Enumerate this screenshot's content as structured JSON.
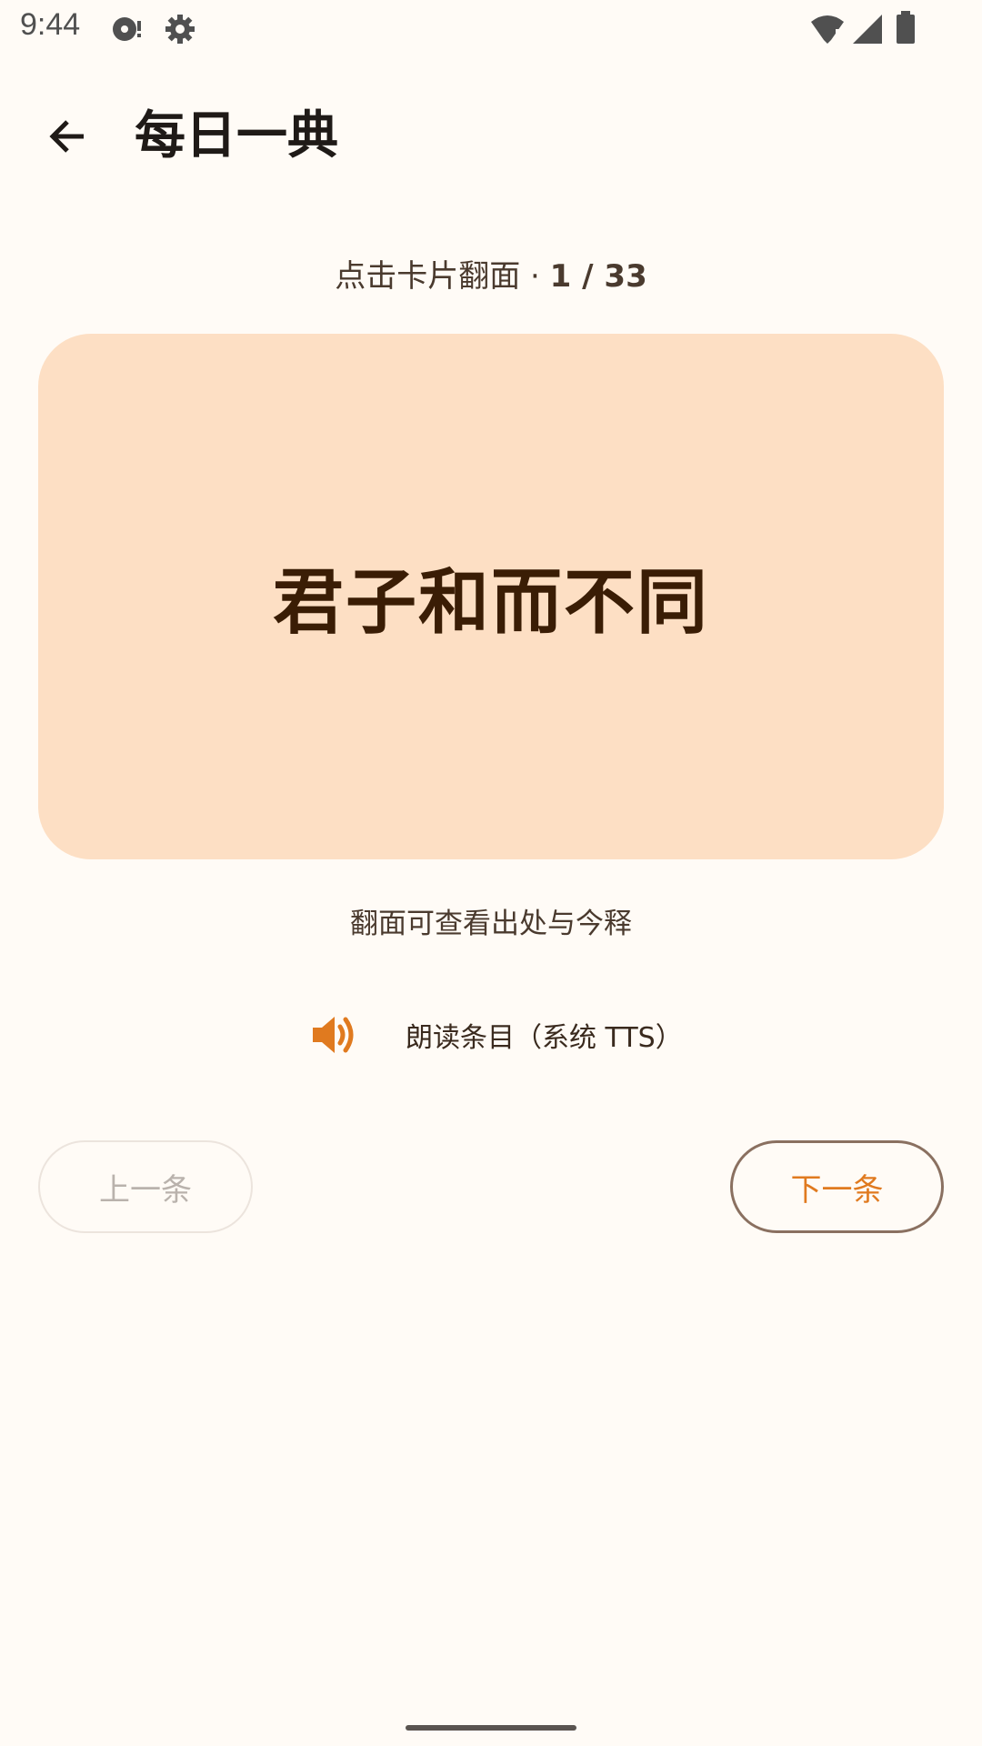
{
  "status_bar": {
    "time": "9:44"
  },
  "app_bar": {
    "title": "每日一典"
  },
  "card": {
    "hint_prefix": "点击卡片翻面 · ",
    "counter": "1 / 33",
    "front_text": "君子和而不同",
    "flip_tip": "翻面可查看出处与今释"
  },
  "tts": {
    "label": "朗读条目（系统 TTS）"
  },
  "buttons": {
    "prev_label": "上一条",
    "next_label": "下一条"
  },
  "colors": {
    "background": "#FFFBF6",
    "card_background": "#FDDFC4",
    "card_text": "#3A1D05",
    "accent": "#E07A1F",
    "disabled_text": "#B9B2AC"
  },
  "icons": {
    "back": "arrow-left-icon",
    "tts": "volume-icon",
    "status": [
      "media-icon",
      "gear-icon",
      "wifi-icon",
      "signal-icon",
      "battery-icon"
    ]
  }
}
